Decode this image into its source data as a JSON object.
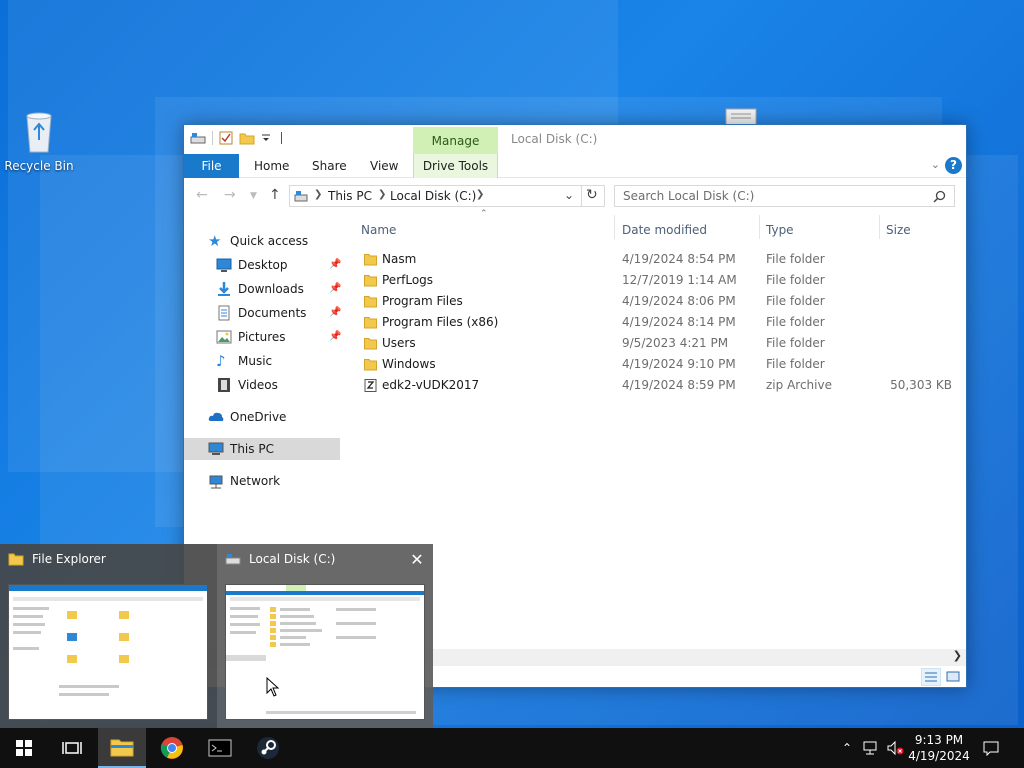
{
  "desktop": {
    "icons": [
      {
        "label": "Recycle Bin",
        "icon": "recycle-bin-icon"
      }
    ]
  },
  "explorer": {
    "window_title": "Local Disk (C:)",
    "context_tab": "Manage",
    "ribbon_tabs": [
      "File",
      "Home",
      "Share",
      "View",
      "Drive Tools"
    ],
    "help_label": "?",
    "breadcrumb": [
      "This PC",
      "Local Disk (C:)"
    ],
    "search_placeholder": "Search Local Disk (C:)",
    "nav": {
      "quick_access": "Quick access",
      "quick_items": [
        "Desktop",
        "Downloads",
        "Documents",
        "Pictures",
        "Music",
        "Videos"
      ],
      "onedrive": "OneDrive",
      "this_pc": "This PC",
      "network": "Network"
    },
    "columns": {
      "name": "Name",
      "date": "Date modified",
      "type": "Type",
      "size": "Size"
    },
    "files": [
      {
        "name": "Nasm",
        "date": "4/19/2024 8:54 PM",
        "type": "File folder",
        "size": "",
        "kind": "folder"
      },
      {
        "name": "PerfLogs",
        "date": "12/7/2019 1:14 AM",
        "type": "File folder",
        "size": "",
        "kind": "folder"
      },
      {
        "name": "Program Files",
        "date": "4/19/2024 8:06 PM",
        "type": "File folder",
        "size": "",
        "kind": "folder"
      },
      {
        "name": "Program Files (x86)",
        "date": "4/19/2024 8:14 PM",
        "type": "File folder",
        "size": "",
        "kind": "folder"
      },
      {
        "name": "Users",
        "date": "9/5/2023 4:21 PM",
        "type": "File folder",
        "size": "",
        "kind": "folder"
      },
      {
        "name": "Windows",
        "date": "4/19/2024 9:10 PM",
        "type": "File folder",
        "size": "",
        "kind": "folder"
      },
      {
        "name": "edk2-vUDK2017",
        "date": "4/19/2024 8:59 PM",
        "type": "zip Archive",
        "size": "50,303 KB",
        "kind": "zip"
      }
    ]
  },
  "thumbnails": [
    {
      "title": "File Explorer",
      "icon": "folder-icon"
    },
    {
      "title": "Local Disk (C:)",
      "icon": "drive-icon"
    }
  ],
  "taskbar": {
    "apps": [
      "start-icon",
      "task-view-icon",
      "file-explorer-icon",
      "chrome-icon",
      "terminal-icon",
      "steam-icon"
    ],
    "time": "9:13 PM",
    "date": "4/19/2024"
  },
  "colors": {
    "accent": "#1979ca",
    "manage_tab": "#d1f0b5",
    "folder": "#f2c94c",
    "taskbar": "#101010"
  }
}
